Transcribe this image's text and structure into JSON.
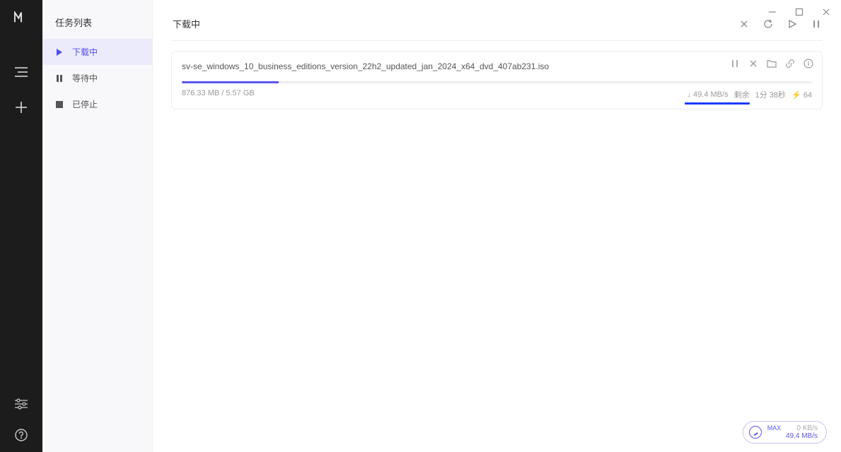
{
  "sidebar": {
    "title": "任务列表",
    "items": [
      {
        "label": "下载中"
      },
      {
        "label": "等待中"
      },
      {
        "label": "已停止"
      }
    ]
  },
  "page": {
    "title": "下载中"
  },
  "task": {
    "filename": "sv-se_windows_10_business_editions_version_22h2_updated_jan_2024_x64_dvd_407ab231.iso",
    "progress_text": "876.33 MB / 5.57 GB",
    "speed": "↓ 49.4 MB/s",
    "remaining_label": "剩余",
    "remaining_value": "1分 38秒",
    "peers": "⚡ 64"
  },
  "status": {
    "max": "MAX",
    "upload": "0 KB/s",
    "download": "49.4 MB/s"
  }
}
